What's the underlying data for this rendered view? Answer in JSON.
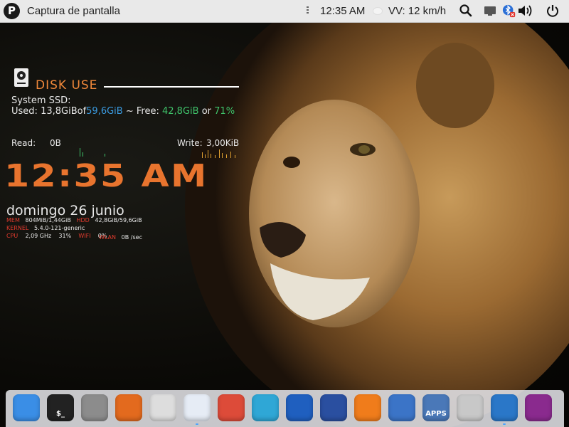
{
  "topbar": {
    "logo_letter": "P",
    "app_title": "Captura de pantalla",
    "clock": "12:35 AM",
    "weather": "VV: 12 km/h",
    "icons": [
      "search-icon",
      "display-icon",
      "bluetooth-icon",
      "volume-icon",
      "power-icon"
    ]
  },
  "disk": {
    "title": "DISK USE",
    "system_label": "System SSD:",
    "used_prefix": "Used:",
    "used": "13,8GiB",
    "of_label": "of",
    "total": "59,6GiB",
    "free_label": "~ Free:",
    "free": "42,8GiB",
    "or_label": "or",
    "percent": "71%",
    "read_label": "Read:",
    "read_value": "0B",
    "write_label": "Write:",
    "write_value": "3,00KiB"
  },
  "clock": {
    "time": "12:35 AM",
    "date": "domingo 26 junio"
  },
  "sysinfo": {
    "mem_label": "MEM",
    "mem_value": "804MiB/1,44GiB",
    "hdd_label": "HDD",
    "hdd_value": "42,8GiB/59,6GiB",
    "kernel_label": "KERNEL",
    "kernel_value": "5.4.0-121-generic",
    "cpu_label": "CPU",
    "cpu_freq": "2,09 GHz",
    "cpu_pct": "31%",
    "wifi_label": "WIFI",
    "wifi_value": "0%",
    "wlan_label": "WLAN",
    "wlan_value": "0B /sec"
  },
  "dock": {
    "items": [
      {
        "name": "finder",
        "color": "#3a8ee6"
      },
      {
        "name": "terminal",
        "label": "$_",
        "color": "#222222"
      },
      {
        "name": "launchpad",
        "color": "#8c8c8c"
      },
      {
        "name": "synaptic",
        "color": "#e36a1e"
      },
      {
        "name": "inkscape",
        "color": "#dddddd"
      },
      {
        "name": "text-editor",
        "color": "#e6ecf5"
      },
      {
        "name": "chrome",
        "color": "#dd4b39"
      },
      {
        "name": "safari",
        "color": "#2fa7d6"
      },
      {
        "name": "xdman",
        "color": "#1f5fbf"
      },
      {
        "name": "thunderbird",
        "color": "#2a4fa0"
      },
      {
        "name": "firefox",
        "color": "#f07c1b"
      },
      {
        "name": "screenshot",
        "color": "#3b74c7"
      },
      {
        "name": "app-store",
        "label": "APPS",
        "color": "#4a78b8"
      },
      {
        "name": "trash",
        "color": "#c8c8c8"
      },
      {
        "name": "app-grid",
        "color": "#2a77c8"
      },
      {
        "name": "games",
        "color": "#8a2a8e"
      }
    ]
  }
}
